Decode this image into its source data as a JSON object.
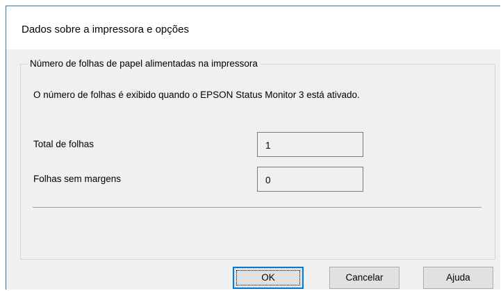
{
  "dialog": {
    "title": "Dados sobre a impressora e opções"
  },
  "group": {
    "legend": "Número de folhas de papel alimentadas na impressora",
    "description": "O número de folhas é exibido quando o EPSON Status Monitor 3 está ativado.",
    "fields": [
      {
        "label": "Total de folhas",
        "value": "1"
      },
      {
        "label": "Folhas sem margens",
        "value": "0"
      }
    ]
  },
  "buttons": {
    "ok": "OK",
    "cancel": "Cancelar",
    "help": "Ajuda"
  }
}
